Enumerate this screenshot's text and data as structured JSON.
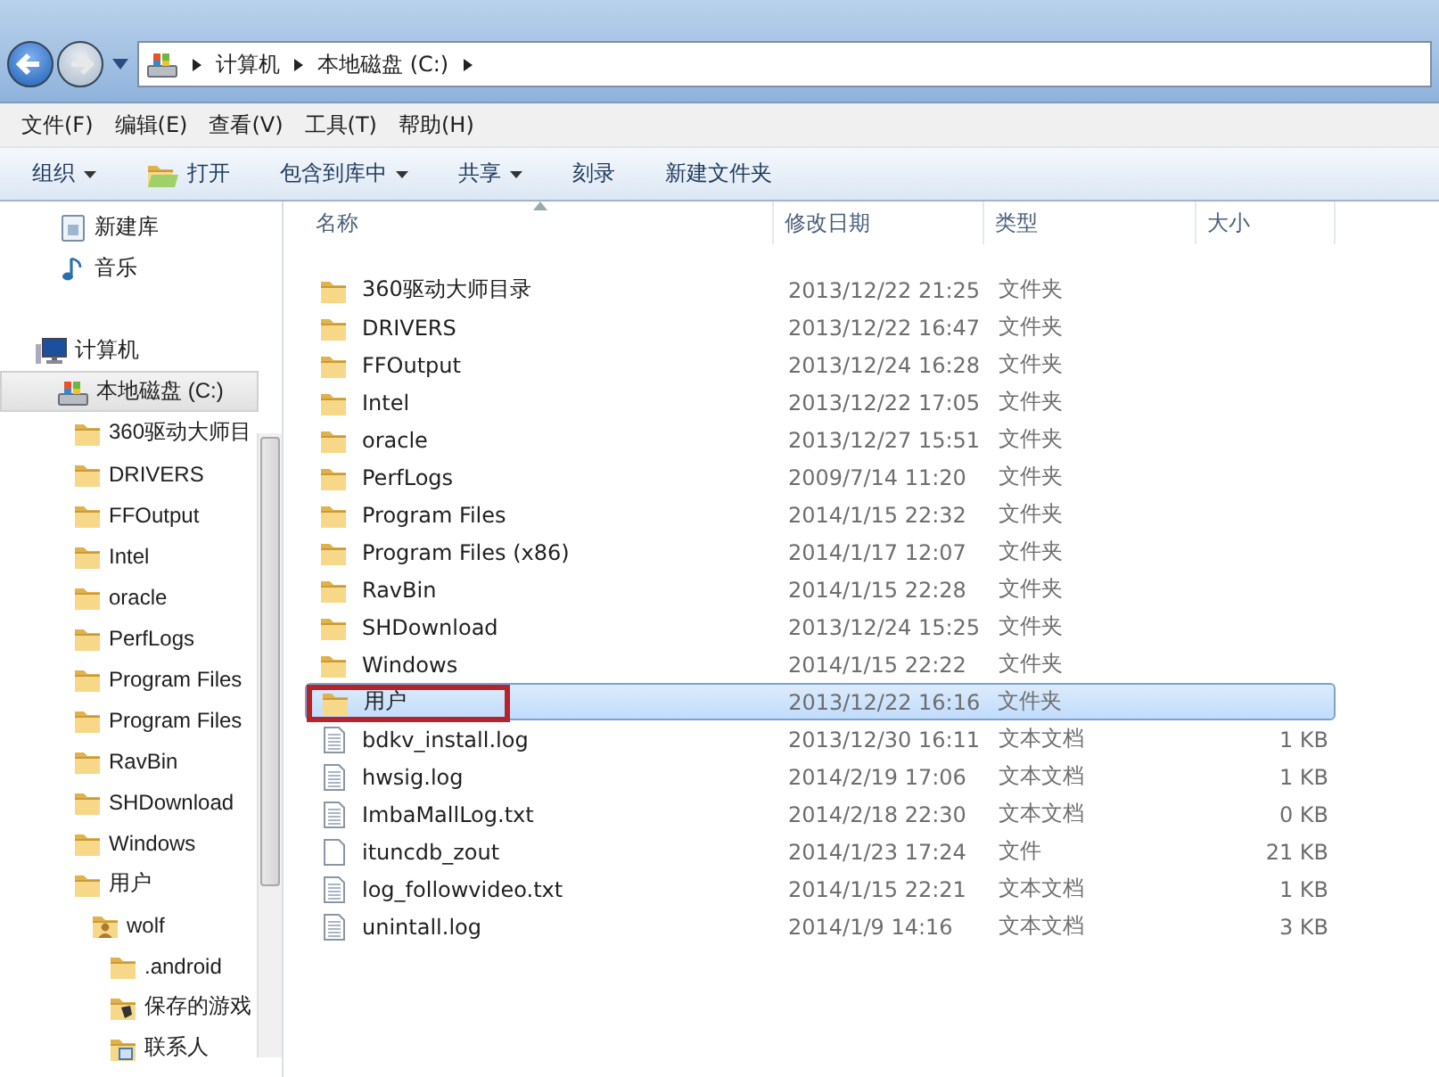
{
  "address_bar": {
    "segments": [
      "计算机",
      "本地磁盘 (C:)"
    ]
  },
  "menu_bar": [
    "文件(F)",
    "编辑(E)",
    "查看(V)",
    "工具(T)",
    "帮助(H)"
  ],
  "toolbar": [
    {
      "label": "组织",
      "kind": "dropdown"
    },
    {
      "label": "打开",
      "kind": "open"
    },
    {
      "label": "包含到库中",
      "kind": "dropdown"
    },
    {
      "label": "共享",
      "kind": "dropdown"
    },
    {
      "label": "刻录",
      "kind": "plain"
    },
    {
      "label": "新建文件夹",
      "kind": "plain"
    }
  ],
  "sidebar": {
    "items": [
      {
        "label": "新建库",
        "kind": "library",
        "selected": false
      },
      {
        "label": "音乐",
        "kind": "music",
        "selected": false
      },
      {
        "label": "计算机",
        "kind": "computer",
        "selected": false,
        "children": [
          {
            "label": "本地磁盘 (C:)",
            "kind": "drive",
            "selected": true,
            "children": [
              {
                "label": "360驱动大师目",
                "kind": "folder",
                "selected": false
              },
              {
                "label": "DRIVERS",
                "kind": "folder",
                "selected": false
              },
              {
                "label": "FFOutput",
                "kind": "folder",
                "selected": false
              },
              {
                "label": "Intel",
                "kind": "folder",
                "selected": false
              },
              {
                "label": "oracle",
                "kind": "folder",
                "selected": false
              },
              {
                "label": "PerfLogs",
                "kind": "folder",
                "selected": false
              },
              {
                "label": "Program Files",
                "kind": "folder",
                "selected": false
              },
              {
                "label": "Program Files",
                "kind": "folder",
                "selected": false
              },
              {
                "label": "RavBin",
                "kind": "folder",
                "selected": false
              },
              {
                "label": "SHDownload",
                "kind": "folder",
                "selected": false
              },
              {
                "label": "Windows",
                "kind": "folder",
                "selected": false
              },
              {
                "label": "用户",
                "kind": "folder",
                "selected": false,
                "children": [
                  {
                    "label": "wolf",
                    "kind": "user",
                    "selected": false,
                    "children": [
                      {
                        "label": ".android",
                        "kind": "folder",
                        "selected": false
                      },
                      {
                        "label": "保存的游戏",
                        "kind": "games",
                        "selected": false
                      },
                      {
                        "label": "联系人",
                        "kind": "contacts",
                        "selected": false
                      }
                    ]
                  }
                ]
              }
            ]
          }
        ]
      }
    ]
  },
  "table": {
    "columns": [
      "名称",
      "修改日期",
      "类型",
      "大小"
    ],
    "rows": [
      {
        "name": "360驱动大师目录",
        "date": "2013/12/22 21:25",
        "type": "文件夹",
        "kind": "folder",
        "selected": false,
        "highlighted": false
      },
      {
        "name": "DRIVERS",
        "date": "2013/12/22 16:47",
        "type": "文件夹",
        "kind": "folder",
        "selected": false,
        "highlighted": false
      },
      {
        "name": "FFOutput",
        "date": "2013/12/24 16:28",
        "type": "文件夹",
        "kind": "folder",
        "selected": false,
        "highlighted": false
      },
      {
        "name": "Intel",
        "date": "2013/12/22 17:05",
        "type": "文件夹",
        "kind": "folder",
        "selected": false,
        "highlighted": false
      },
      {
        "name": "oracle",
        "date": "2013/12/27 15:51",
        "type": "文件夹",
        "kind": "folder",
        "selected": false,
        "highlighted": false
      },
      {
        "name": "PerfLogs",
        "date": "2009/7/14 11:20",
        "type": "文件夹",
        "kind": "folder",
        "selected": false,
        "highlighted": false
      },
      {
        "name": "Program Files",
        "date": "2014/1/15 22:32",
        "type": "文件夹",
        "kind": "folder",
        "selected": false,
        "highlighted": false
      },
      {
        "name": "Program Files (x86)",
        "date": "2014/1/17 12:07",
        "type": "文件夹",
        "kind": "folder",
        "selected": false,
        "highlighted": false
      },
      {
        "name": "RavBin",
        "date": "2014/1/15 22:28",
        "type": "文件夹",
        "kind": "folder",
        "selected": false,
        "highlighted": false
      },
      {
        "name": "SHDownload",
        "date": "2013/12/24 15:25",
        "type": "文件夹",
        "kind": "folder",
        "selected": false,
        "highlighted": false
      },
      {
        "name": "Windows",
        "date": "2014/1/15 22:22",
        "type": "文件夹",
        "kind": "folder",
        "selected": false,
        "highlighted": false
      },
      {
        "name": "用户",
        "date": "2013/12/22 16:16",
        "type": "文件夹",
        "kind": "folder",
        "selected": true,
        "highlighted": true
      },
      {
        "name": "bdkv_install.log",
        "date": "2013/12/30 16:11",
        "type": "文本文档",
        "size": "1 KB",
        "kind": "text",
        "selected": false,
        "highlighted": false
      },
      {
        "name": "hwsig.log",
        "date": "2014/2/19 17:06",
        "type": "文本文档",
        "size": "1 KB",
        "kind": "text",
        "selected": false,
        "highlighted": false
      },
      {
        "name": "ImbaMallLog.txt",
        "date": "2014/2/18 22:30",
        "type": "文本文档",
        "size": "0 KB",
        "kind": "text",
        "selected": false,
        "highlighted": false
      },
      {
        "name": "ituncdb_zout",
        "date": "2014/1/23 17:24",
        "type": "文件",
        "size": "21 KB",
        "kind": "file",
        "selected": false,
        "highlighted": false
      },
      {
        "name": "log_followvideo.txt",
        "date": "2014/1/15 22:21",
        "type": "文本文档",
        "size": "1 KB",
        "kind": "text",
        "selected": false,
        "highlighted": false
      },
      {
        "name": "unintall.log",
        "date": "2014/1/9 14:16",
        "type": "文本文档",
        "size": "3 KB",
        "kind": "text",
        "selected": false,
        "highlighted": false
      }
    ]
  }
}
